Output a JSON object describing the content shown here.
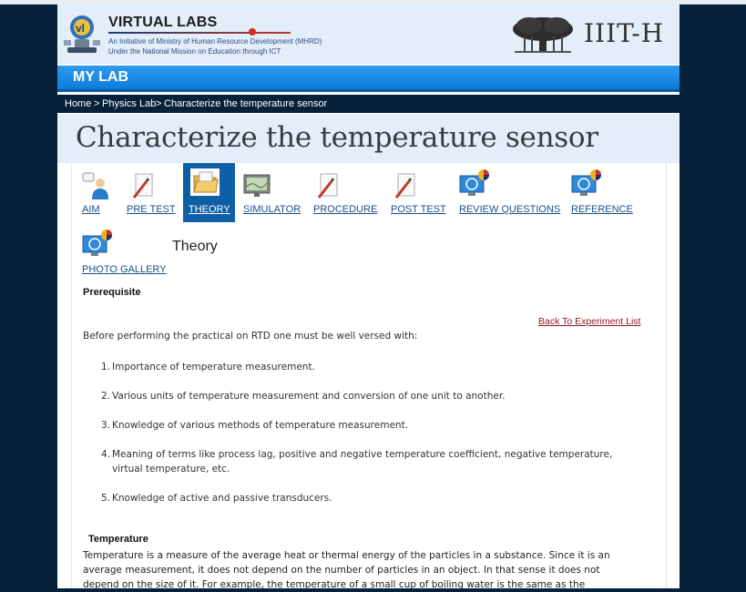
{
  "header": {
    "brand_title": "VIRTUAL LABS",
    "brand_subtitle_1": "An Initiative of Ministry of Human Resource Development (MHRD)",
    "brand_subtitle_2": "Under the National Mission on Education through ICT",
    "institute": "IIIT-H"
  },
  "mylab": {
    "label": "MY LAB"
  },
  "breadcrumb": {
    "home": "Home",
    "sep1": ">",
    "lab": "Physics Lab",
    "sep2": ">",
    "current": "Characterize the temperature sensor"
  },
  "page_title": "Characterize the temperature sensor",
  "nav": {
    "items": [
      {
        "label": "AIM",
        "icon": "person-icon"
      },
      {
        "label": "PRE TEST",
        "icon": "pencil-paper-icon"
      },
      {
        "label": "THEORY",
        "icon": "folder-icon",
        "active": true
      },
      {
        "label": "SIMULATOR",
        "icon": "monitor-icon"
      },
      {
        "label": "PROCEDURE",
        "icon": "pencil-paper-icon"
      },
      {
        "label": "POST TEST",
        "icon": "pencil-paper-icon"
      },
      {
        "label": "REVIEW QUESTIONS",
        "icon": "monitor-globe-icon"
      },
      {
        "label": "REFERENCE",
        "icon": "monitor-globe-icon"
      },
      {
        "label": "PHOTO GALLERY",
        "icon": "monitor-globe-icon"
      }
    ],
    "active_color": "#0e5fa6",
    "link_color": "#1a4f8c"
  },
  "content": {
    "section_label": "Theory",
    "prerequisite_heading": "Prerequisite",
    "back_link": "Back To Experiment List",
    "intro": "Before performing the practical on RTD one must be well versed with:",
    "prerequisites": [
      {
        "num": "1.",
        "text": "Importance of temperature measurement."
      },
      {
        "num": "2.",
        "text": "Various units of temperature measurement and conversion of one unit to another."
      },
      {
        "num": "3.",
        "text": "Knowledge of various methods of temperature measurement."
      },
      {
        "num": "4.",
        "text": "Meaning of terms like process lag, positive and negative temperature coefficient, negative temperature, virtual temperature, etc."
      },
      {
        "num": "5.",
        "text": "Knowledge of active and passive transducers."
      }
    ],
    "temperature_heading": "Temperature",
    "temperature_paragraph": "Temperature is a measure of the average heat or thermal energy of the particles in a substance. Since it is an average measurement, it does not depend on the number of particles in an object. In that sense it does not depend on the size of it. For example, the temperature of a small cup of boiling water is the same as the"
  },
  "colors": {
    "background": "#07213a",
    "header_bg": "#e3eef8",
    "mylab_bar": "#0d7bd8",
    "back_link": "#8b1a1a"
  }
}
